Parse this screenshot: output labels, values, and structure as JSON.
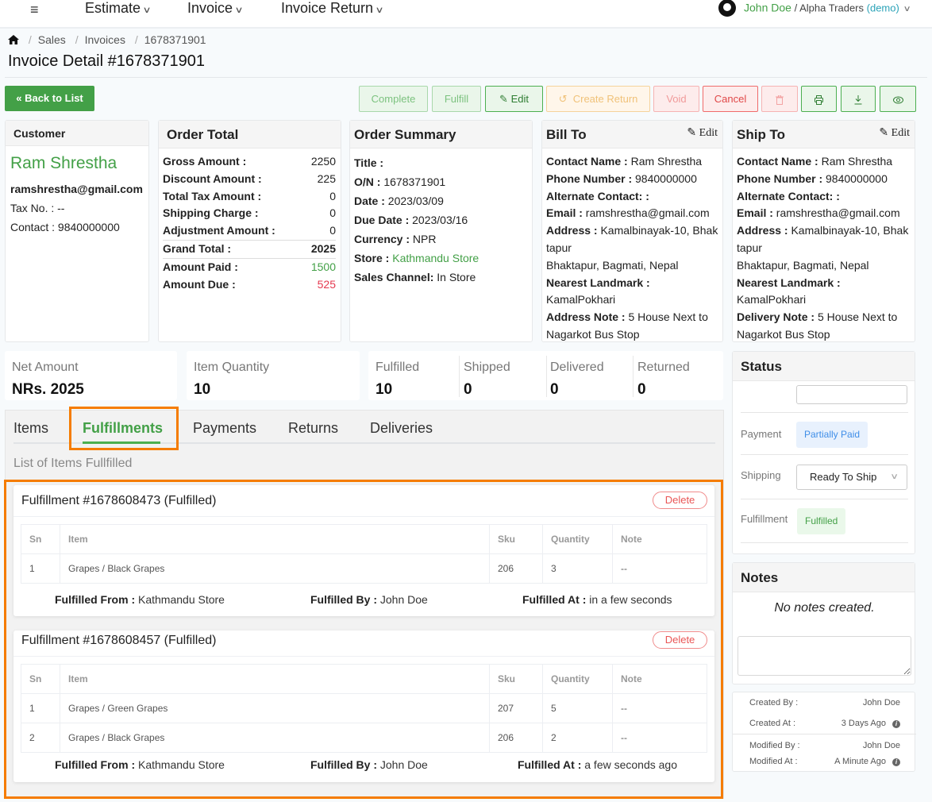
{
  "topbar": {
    "menu_icon": "menu-icon",
    "nav": [
      {
        "label": "Estimate"
      },
      {
        "label": "Invoice"
      },
      {
        "label": "Invoice Return"
      }
    ],
    "user": {
      "name": "John Doe",
      "org": "/ Alpha Traders",
      "demo": "(demo)"
    }
  },
  "breadcrumb": {
    "items": [
      "Sales",
      "Invoices",
      "1678371901"
    ]
  },
  "page_title": "Invoice Detail #1678371901",
  "actions": {
    "back": "Back to List",
    "complete": "Complete",
    "fulfill": "Fulfill",
    "edit": "Edit",
    "create_return": "Create Return",
    "void": "Void",
    "cancel": "Cancel"
  },
  "customer": {
    "header": "Customer",
    "name": "Ram Shrestha",
    "email": "ramshrestha@gmail.com",
    "tax_label": "Tax No. :",
    "tax_value": "--",
    "contact_label": "Contact :",
    "contact_value": "9840000000"
  },
  "order_total": {
    "header": "Order Total",
    "rows": [
      {
        "label": "Gross Amount :",
        "value": "2250"
      },
      {
        "label": "Discount Amount :",
        "value": "225"
      },
      {
        "label": "Total Tax Amount :",
        "value": "0"
      },
      {
        "label": "Shipping Charge :",
        "value": "0"
      },
      {
        "label": "Adjustment Amount :",
        "value": "0"
      },
      {
        "label": "Grand Total :",
        "value": "2025"
      },
      {
        "label": "Amount Paid :",
        "value": "1500"
      },
      {
        "label": "Amount Due :",
        "value": "525"
      }
    ]
  },
  "order_summary": {
    "header": "Order Summary",
    "title_label": "Title :",
    "on_label": "O/N :",
    "on_value": "1678371901",
    "date_label": "Date :",
    "date_value": "2023/03/09",
    "due_label": "Due Date :",
    "due_value": "2023/03/16",
    "currency_label": "Currency :",
    "currency_value": "NPR",
    "store_label": "Store :",
    "store_value": "Kathmandu Store",
    "channel_label": "Sales Channel:",
    "channel_value": "In Store"
  },
  "bill_to": {
    "header": "Bill To",
    "edit": "Edit",
    "contact_label": "Contact Name :",
    "contact_value": "Ram Shrestha",
    "phone_label": "Phone Number :",
    "phone_value": "9840000000",
    "alt_label": "Alternate Contact: :",
    "email_label": "Email :",
    "email_value": "ramshrestha@gmail.com",
    "address_label": "Address :",
    "address_value": "Kamalbinayak-10, Bhaktapur",
    "address_line2": "Bhaktapur, Bagmati, Nepal",
    "landmark_label": "Nearest Landmark :",
    "landmark_value": "KamalPokhari",
    "note_label": "Address Note :",
    "note_value": "5 House Next to Nagarkot Bus Stop"
  },
  "ship_to": {
    "header": "Ship To",
    "edit": "Edit",
    "contact_label": "Contact Name :",
    "contact_value": "Ram Shrestha",
    "phone_label": "Phone Number :",
    "phone_value": "9840000000",
    "alt_label": "Alternate Contact: :",
    "email_label": "Email :",
    "email_value": "ramshrestha@gmail.com",
    "address_label": "Address :",
    "address_value": "Kamalbinayak-10, Bhaktapur",
    "address_line2": "Bhaktapur, Bagmati, Nepal",
    "landmark_label": "Nearest Landmark :",
    "landmark_value": "KamalPokhari",
    "note_label": "Delivery Note :",
    "note_value": "5 House Next to Nagarkot Bus Stop"
  },
  "stats": {
    "net_amount_label": "Net Amount",
    "net_amount_value": "NRs. 2025",
    "item_qty_label": "Item Quantity",
    "item_qty_value": "10",
    "fulfilled_label": "Fulfilled",
    "fulfilled_value": "10",
    "shipped_label": "Shipped",
    "shipped_value": "0",
    "delivered_label": "Delivered",
    "delivered_value": "0",
    "returned_label": "Returned",
    "returned_value": "0"
  },
  "tabs": [
    {
      "label": "Items",
      "active": false
    },
    {
      "label": "Fulfillments",
      "active": true
    },
    {
      "label": "Payments",
      "active": false
    },
    {
      "label": "Returns",
      "active": false
    },
    {
      "label": "Deliveries",
      "active": false
    }
  ],
  "list_caption": "List of Items Fullfilled",
  "table_headers": [
    "Sn",
    "Item",
    "Sku",
    "Quantity",
    "Note"
  ],
  "fulfillments": [
    {
      "title": "Fulfillment #1678608473 (Fulfilled)",
      "delete": "Delete",
      "rows": [
        {
          "sn": "1",
          "item": "Grapes / Black Grapes",
          "sku": "206",
          "qty": "3",
          "note": "--"
        }
      ],
      "from_label": "Fulfilled From :",
      "from_value": "Kathmandu Store",
      "by_label": "Fulfilled By :",
      "by_value": "John Doe",
      "at_label": "Fulfilled At :",
      "at_value": "in a few seconds"
    },
    {
      "title": "Fulfillment #1678608457 (Fulfilled)",
      "delete": "Delete",
      "rows": [
        {
          "sn": "1",
          "item": "Grapes / Green Grapes",
          "sku": "207",
          "qty": "5",
          "note": "--"
        },
        {
          "sn": "2",
          "item": "Grapes / Black Grapes",
          "sku": "206",
          "qty": "2",
          "note": "--"
        }
      ],
      "from_label": "Fulfilled From :",
      "from_value": "Kathmandu Store",
      "by_label": "Fulfilled By :",
      "by_value": "John Doe",
      "at_label": "Fulfilled At :",
      "at_value": "a few seconds ago"
    }
  ],
  "status": {
    "header": "Status",
    "payment_label": "Payment",
    "payment_value": "Partially Paid",
    "shipping_label": "Shipping",
    "shipping_value": "Ready To Ship",
    "fulfillment_label": "Fulfillment",
    "fulfillment_value": "Fulfilled"
  },
  "notes": {
    "header": "Notes",
    "empty": "No notes created."
  },
  "meta": {
    "created_by_label": "Created By :",
    "created_by_value": "John Doe",
    "created_at_label": "Created At :",
    "created_at_value": "3 Days Ago",
    "modified_by_label": "Modified By :",
    "modified_by_value": "John Doe",
    "modified_at_label": "Modified At :",
    "modified_at_value": "A Minute Ago"
  },
  "colors": {
    "brand_green": "#43a047",
    "danger": "#e53950",
    "info": "#3f8ee8",
    "highlight": "#f57c00"
  }
}
